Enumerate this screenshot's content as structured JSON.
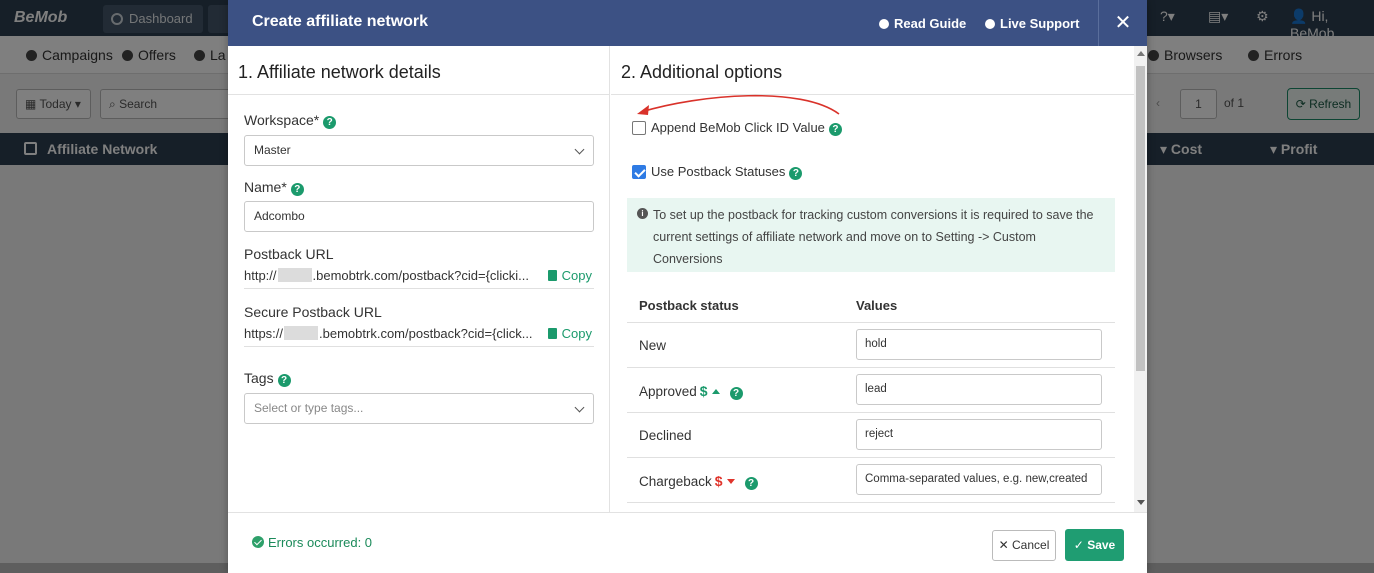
{
  "app": {
    "logo": "BeMob",
    "top_tabs": [
      "Dashboard",
      "La"
    ],
    "user": "Hi, BeMob",
    "subnav": [
      "Campaigns",
      "Offers",
      "La",
      "Browsers",
      "Errors"
    ],
    "toolbar": {
      "date_range": "Today",
      "search_placeholder": "Search",
      "page": "1",
      "page_of": "of 1",
      "refresh_label": "Refresh"
    },
    "grid_columns": [
      "Affiliate Network",
      "Cost",
      "Profit"
    ]
  },
  "modal": {
    "title": "Create affiliate network",
    "read_guide": "Read Guide",
    "live_support": "Live Support",
    "close": "✕",
    "left": {
      "section_title": "1. Affiliate network details",
      "workspace_label": "Workspace*",
      "workspace_value": "Master",
      "name_label": "Name*",
      "name_value": "Adcombo",
      "postback_label": "Postback URL",
      "postback_prefix": "http://",
      "postback_suffix": ".bemobtrk.com/postback?cid={clicki...",
      "secure_postback_label": "Secure Postback URL",
      "secure_prefix": "https://",
      "secure_suffix": ".bemobtrk.com/postback?cid={click...",
      "copy_label": "Copy",
      "tags_label": "Tags",
      "tags_placeholder": "Select or type tags..."
    },
    "right": {
      "section_title": "2. Additional options",
      "append_label": "Append BeMob Click ID Value",
      "append_checked": false,
      "use_statuses_label": "Use Postback Statuses",
      "use_statuses_checked": true,
      "info_text": "To set up the postback for tracking custom conversions it is required to save the current settings of affiliate network and move on to Setting -> Custom Conversions",
      "col_status": "Postback status",
      "col_values": "Values",
      "rows": [
        {
          "label": "New",
          "value": "hold",
          "placeholder": ""
        },
        {
          "label": "Approved",
          "value": "lead",
          "placeholder": ""
        },
        {
          "label": "Declined",
          "value": "reject",
          "placeholder": ""
        },
        {
          "label": "Chargeback",
          "value": "",
          "placeholder": "Comma-separated values, e.g. new,created"
        }
      ]
    },
    "footer": {
      "errors": "Errors occurred: 0",
      "cancel": "Cancel",
      "save": "Save"
    },
    "colors": {
      "header": "#3c5184",
      "accent": "#1f9d72",
      "annotation_arrow": "#d9322a"
    }
  }
}
